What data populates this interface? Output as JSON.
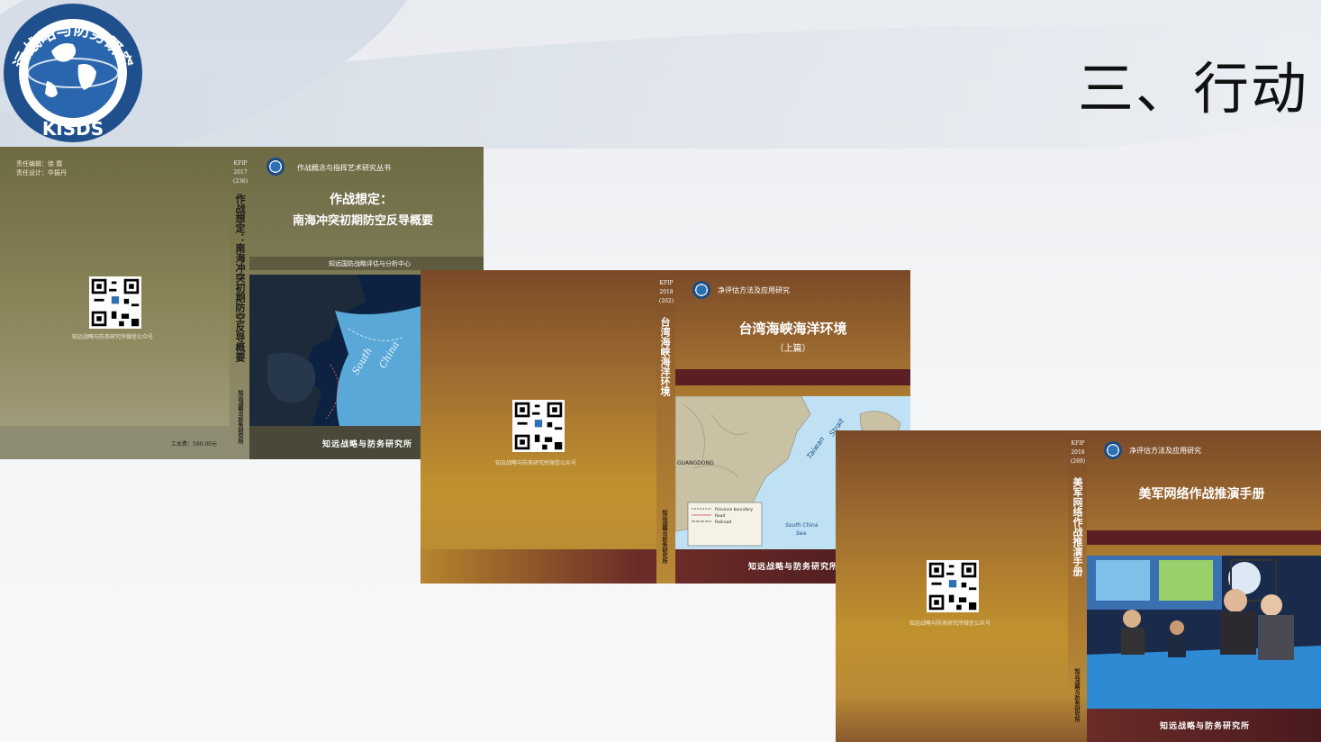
{
  "slide": {
    "title": "三、行动",
    "logo": {
      "text": "知远战略与防务研究所",
      "abbr": "KISDS",
      "icon": "globe-icon"
    }
  },
  "books": [
    {
      "editor_line": "责任编辑：徐  霞",
      "designer_line": "责任设计：华振丹",
      "code": [
        "KFIP",
        "2017",
        "(236)"
      ],
      "spine_title": "作战想定：南海冲突初期防空反导概要",
      "spine_publisher": "知远战略与防务研究所",
      "series": "作战概念与指挥艺术研究丛书",
      "title_line1": "作战想定：",
      "title_line2": "南海冲突初期防空反导概要",
      "banner": "知远国防战略评估与分析中心",
      "qr_caption": "知远战略与防务研究所微信公众号",
      "price": "工本费：580.00元",
      "publisher": "知远战略与防务研究所",
      "map_labels": [
        "South",
        "China"
      ]
    },
    {
      "code": [
        "KFIP",
        "2018",
        "(262)"
      ],
      "spine_title": "台湾海峡海洋环境",
      "spine_publisher": "知远战略与防务研究所",
      "series": "净评估方法及应用研究",
      "title_line1": "台湾海峡海洋环境",
      "title_line2": "（上篇）",
      "qr_caption": "知远战略与防务研究所微信公众号",
      "publisher": "知远战略与防务研究所",
      "map_labels": [
        "Taiwan",
        "Strait",
        "South China",
        "Sea",
        "GUANGDONG"
      ],
      "legend": [
        "Province boundary",
        "Road",
        "Railroad"
      ]
    },
    {
      "code": [
        "KFIP",
        "2018",
        "(269)"
      ],
      "spine_title": "美军网络作战推演手册",
      "spine_publisher": "知远战略与防务研究所",
      "series": "净评估方法及应用研究",
      "title_line1": "美军网络作战推演手册",
      "qr_caption": "知远战略与防务研究所微信公众号",
      "publisher": "知远战略与防务研究所"
    }
  ],
  "colors": {
    "olive": "#8a8458",
    "gold": "#b88a36",
    "maroon": "#5a1f22"
  }
}
